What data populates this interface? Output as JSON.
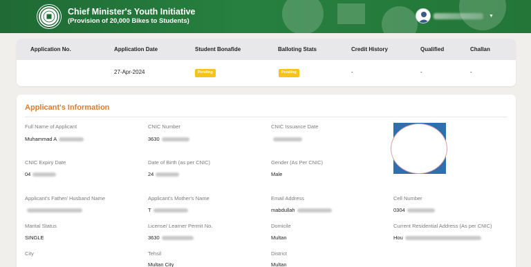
{
  "header": {
    "title": "Chief Minister's Youth Initiative",
    "subtitle": "(Provision of 20,000 Bikes to Students)",
    "user_name": "Muhammad",
    "colors": {
      "bar": "#237637",
      "accent": "#e07b2c",
      "badge": "#f6c21b"
    }
  },
  "application": {
    "columns": [
      "Application No.",
      "Application Date",
      "Student Bonafide",
      "Balloting Stats",
      "Credit History",
      "Qualified",
      "Challan"
    ],
    "row": {
      "application_no": "",
      "application_date": "27-Apr-2024",
      "student_bonafide": "Pending",
      "balloting_stats": "Pending",
      "credit_history": "-",
      "qualified": "-",
      "challan": "-"
    }
  },
  "applicant": {
    "section_title": "Applicant's Information",
    "fields": {
      "full_name": {
        "label": "Full Name of Applicant",
        "value": "Muhammad A"
      },
      "cnic_number": {
        "label": "CNIC Number",
        "value": "3630"
      },
      "cnic_issuance": {
        "label": "CNIC Issuance Date",
        "value": ""
      },
      "cnic_expiry": {
        "label": "CNIC Expiry Date",
        "value": "04"
      },
      "dob": {
        "label": "Date of Birth (as per CNIC)",
        "value": "24"
      },
      "gender": {
        "label": "Gender (As Per CNIC)",
        "value": "Male"
      },
      "father_name": {
        "label": "Applicant's Father/ Husband Name",
        "value": ""
      },
      "mother_name": {
        "label": "Applicant's Mother's Name",
        "value": "T"
      },
      "email": {
        "label": "Email Address",
        "value": "mabdullah"
      },
      "cell": {
        "label": "Cell Number",
        "value": "0304"
      },
      "marital": {
        "label": "Marital Status",
        "value": "SINGLE"
      },
      "license": {
        "label": "License/ Learner Permit No.",
        "value": "3630"
      },
      "domicile": {
        "label": "Domicile",
        "value": "Multan"
      },
      "address": {
        "label": "Current Residential Address (As per CNIC)",
        "value": "Hou"
      },
      "city": {
        "label": "City",
        "value": ""
      },
      "tehsil": {
        "label": "Tehsil",
        "value": "Multan City"
      },
      "district": {
        "label": "District",
        "value": "Multan"
      }
    }
  }
}
